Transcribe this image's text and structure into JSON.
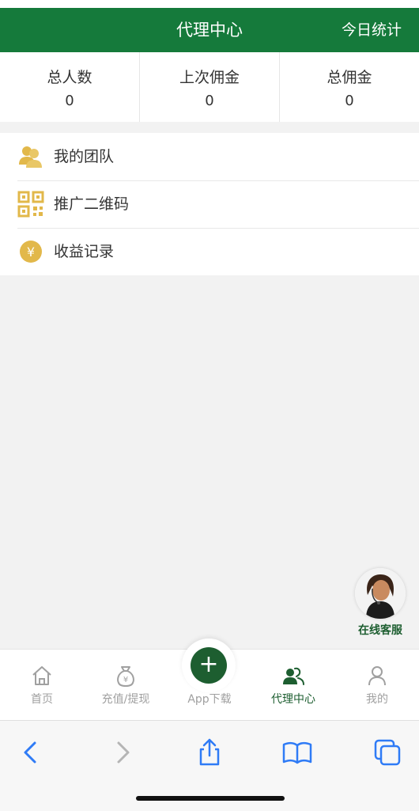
{
  "header": {
    "title": "代理中心",
    "right_action": "今日统计"
  },
  "stats": [
    {
      "label": "总人数",
      "value": "0"
    },
    {
      "label": "上次佣金",
      "value": "0"
    },
    {
      "label": "总佣金",
      "value": "0"
    }
  ],
  "menu": [
    {
      "label": "我的团队",
      "icon": "team-icon"
    },
    {
      "label": "推广二维码",
      "icon": "qrcode-icon"
    },
    {
      "label": "收益记录",
      "icon": "yen-coin-icon"
    }
  ],
  "customer_service": {
    "label": "在线客服"
  },
  "tabs": [
    {
      "label": "首页",
      "icon": "home-icon"
    },
    {
      "label": "充值/提现",
      "icon": "money-bag-icon"
    },
    {
      "label": "App下载",
      "icon": "plus-icon"
    },
    {
      "label": "代理中心",
      "icon": "agent-icon",
      "active": true
    },
    {
      "label": "我的",
      "icon": "user-icon"
    }
  ],
  "colors": {
    "brand_green": "#157a3b",
    "dark_green": "#1d5e30",
    "gold": "#e2b84a",
    "ios_blue": "#2f7bf6"
  }
}
